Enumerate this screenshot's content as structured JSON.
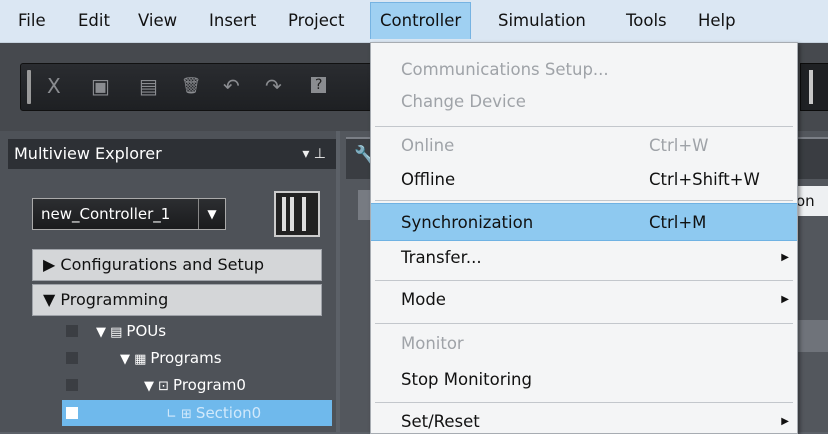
{
  "menubar": {
    "items": [
      "File",
      "Edit",
      "View",
      "Insert",
      "Project",
      "Controller",
      "Simulation",
      "Tools",
      "Help"
    ],
    "active": "Controller"
  },
  "toolbar": {
    "icons": [
      "cut-icon",
      "copy-icon",
      "paste-icon",
      "delete-icon",
      "undo-icon",
      "redo-icon",
      "help-icon"
    ],
    "glyphs": [
      "X",
      "▣",
      "▤",
      "🗑",
      "↶",
      "↷",
      "?"
    ]
  },
  "explorer": {
    "title": "Multiview Explorer",
    "pin_glyph": "▾ ⊥",
    "controller_name": "new_Controller_1",
    "dropdown_arrow": "▼",
    "sections": [
      {
        "label": "▶ Configurations and Setup"
      },
      {
        "label": "▼ Programming"
      }
    ],
    "tree": [
      {
        "label": "POUs",
        "prefix": "▼ ▤"
      },
      {
        "label": "Programs",
        "prefix": "▼ ▦"
      },
      {
        "label": "Program0",
        "prefix": "▼ ⊡"
      },
      {
        "label": "Section0",
        "prefix": "∟ ⊞"
      }
    ]
  },
  "workspace": {
    "tab_glyph": "🔧",
    "partial_tab_text": "on"
  },
  "controller_menu": {
    "items": [
      {
        "label": "Communications Setup...",
        "shortcut": "",
        "disabled": true,
        "submenu": false
      },
      {
        "label": "Change Device",
        "shortcut": "",
        "disabled": true,
        "submenu": false
      },
      {
        "label": "Online",
        "shortcut": "Ctrl+W",
        "disabled": true,
        "submenu": false
      },
      {
        "label": "Offline",
        "shortcut": "Ctrl+Shift+W",
        "disabled": false,
        "submenu": false
      },
      {
        "label": "Synchronization",
        "shortcut": "Ctrl+M",
        "disabled": false,
        "submenu": false,
        "highlighted": true
      },
      {
        "label": "Transfer...",
        "shortcut": "",
        "disabled": false,
        "submenu": true
      },
      {
        "label": "Mode",
        "shortcut": "",
        "disabled": false,
        "submenu": true
      },
      {
        "label": "Monitor",
        "shortcut": "",
        "disabled": true,
        "submenu": false
      },
      {
        "label": "Stop Monitoring",
        "shortcut": "",
        "disabled": false,
        "submenu": false
      },
      {
        "label": "Set/Reset",
        "shortcut": "",
        "disabled": false,
        "submenu": true
      }
    ],
    "submenu_glyph": "▶"
  }
}
